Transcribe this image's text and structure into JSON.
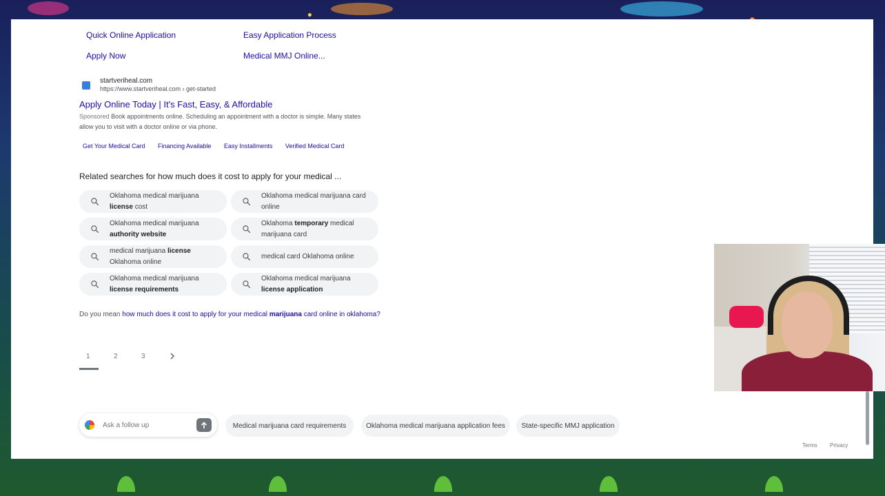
{
  "sitelinks": {
    "quick_online_application": "Quick Online Application",
    "easy_application_process": "Easy Application Process",
    "apply_now": "Apply Now",
    "medical_mmj_online": "Medical MMJ Online..."
  },
  "ad": {
    "site_name": "startveriheal.com",
    "url": "https://www.startveriheal.com › get-started",
    "title": "Apply Online Today | It's Fast, Easy, & Affordable",
    "sponsored": "Sponsored",
    "description": "Book appointments online. Scheduling an appointment with a doctor is simple. Many states allow you to visit with a doctor online or via phone.",
    "links": [
      "Get Your Medical Card",
      "Financing Available",
      "Easy Installments",
      "Verified Medical Card"
    ]
  },
  "related": {
    "title": "Related searches for how much does it cost to apply for your medical ...",
    "chips": [
      {
        "pre": "Oklahoma medical marijuana",
        "bold": "license",
        "post": "cost"
      },
      {
        "pre": "Oklahoma medical marijuana",
        "bold": "",
        "post": "card online"
      },
      {
        "pre": "Oklahoma medical marijuana",
        "bold": "authority website",
        "post": ""
      },
      {
        "pre": "Oklahoma",
        "bold": "temporary",
        "post": "medical marijuana card"
      },
      {
        "pre": "medical marijuana",
        "bold": "license",
        "post": "Oklahoma online"
      },
      {
        "pre": "medical card Oklahoma online",
        "bold": "",
        "post": ""
      },
      {
        "pre": "Oklahoma medical marijuana",
        "bold": "license requirements",
        "post": ""
      },
      {
        "pre": "Oklahoma medical marijuana",
        "bold": "license application",
        "post": ""
      }
    ]
  },
  "did_you_mean": {
    "prefix": "Do you mean",
    "pre": "how much does it cost to apply for your medical",
    "bold": "marijuana",
    "post": "card online in oklahoma?"
  },
  "pagination": {
    "pages": [
      "1",
      "2",
      "3"
    ],
    "next_icon": "chevron-right-icon",
    "current": "1"
  },
  "ask": {
    "placeholder": "Ask a follow up",
    "send_icon": "arrow-up-icon"
  },
  "suggestions": [
    "Medical marijuana card requirements",
    "Oklahoma medical marijuana application fees",
    "State-specific MMJ application"
  ],
  "footer": {
    "terms": "Terms",
    "privacy": "Privacy"
  },
  "colors": {
    "link": "#1a0dab",
    "chip_bg": "#f1f3f4",
    "text": "#202124"
  }
}
